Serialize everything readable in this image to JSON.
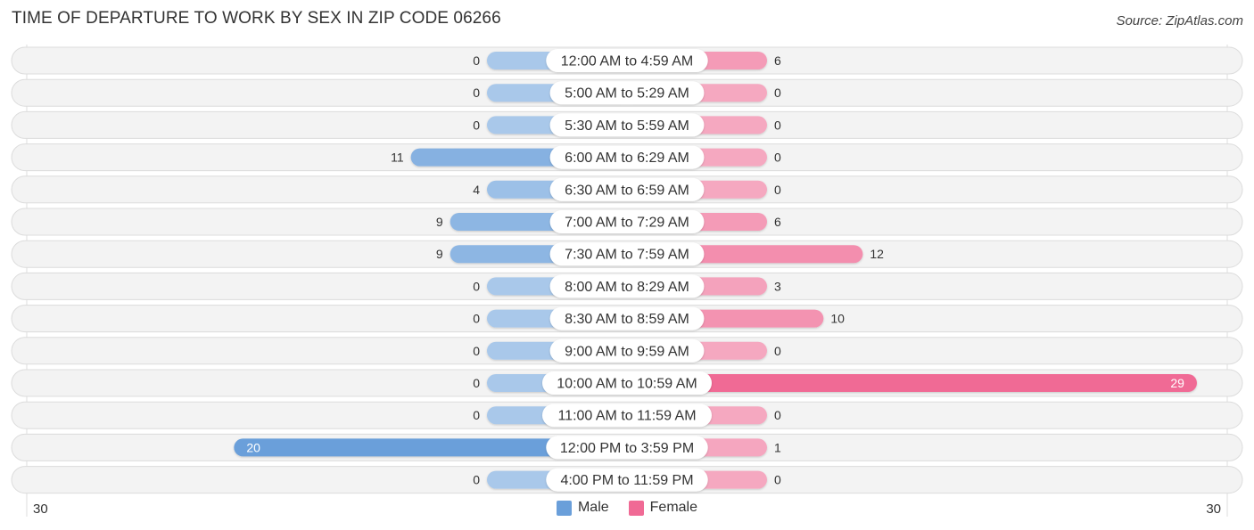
{
  "title": "TIME OF DEPARTURE TO WORK BY SEX IN ZIP CODE 06266",
  "source": "Source: ZipAtlas.com",
  "colors": {
    "male_strong": "#6a9fda",
    "male_light": "#a9c8ea",
    "female_strong": "#f06a95",
    "female_light": "#f5a8c0",
    "row_bg": "#f3f3f3",
    "row_border": "#dcdcdc"
  },
  "chart_data": {
    "type": "bar",
    "orientation": "horizontal-diverging",
    "title": "TIME OF DEPARTURE TO WORK BY SEX IN ZIP CODE 06266",
    "categories": [
      "12:00 AM to 4:59 AM",
      "5:00 AM to 5:29 AM",
      "5:30 AM to 5:59 AM",
      "6:00 AM to 6:29 AM",
      "6:30 AM to 6:59 AM",
      "7:00 AM to 7:29 AM",
      "7:30 AM to 7:59 AM",
      "8:00 AM to 8:29 AM",
      "8:30 AM to 8:59 AM",
      "9:00 AM to 9:59 AM",
      "10:00 AM to 10:59 AM",
      "11:00 AM to 11:59 AM",
      "12:00 PM to 3:59 PM",
      "4:00 PM to 11:59 PM"
    ],
    "series": [
      {
        "name": "Male",
        "values": [
          0,
          0,
          0,
          11,
          4,
          9,
          9,
          0,
          0,
          0,
          0,
          0,
          20,
          0
        ]
      },
      {
        "name": "Female",
        "values": [
          6,
          0,
          0,
          0,
          0,
          6,
          12,
          3,
          10,
          0,
          29,
          0,
          1,
          0
        ]
      }
    ],
    "axis_range": [
      30,
      30
    ],
    "axis_tick_left": "30",
    "axis_tick_right": "30",
    "legend": [
      "Male",
      "Female"
    ],
    "legend_position": "bottom-center",
    "grid": false
  }
}
